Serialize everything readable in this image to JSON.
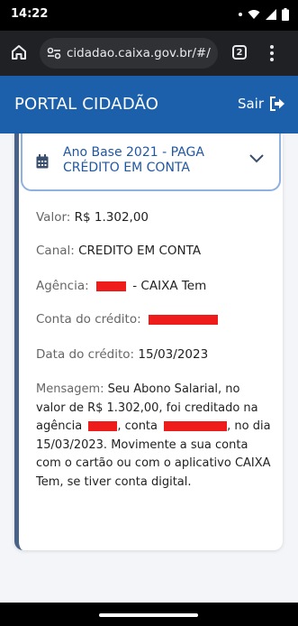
{
  "status_bar": {
    "time": "14:22"
  },
  "browser": {
    "url": "cidadao.caixa.gov.br/#/a",
    "tab_count": "2"
  },
  "header": {
    "title": "PORTAL CIDADÃO",
    "logout_label": "Sair"
  },
  "accordion": {
    "title": "Ano Base 2021 - PAGA CRÉDITO EM CONTA"
  },
  "details": {
    "valor_label": "Valor:",
    "valor_value": "R$ 1.302,00",
    "canal_label": "Canal:",
    "canal_value": "CREDITO EM CONTA",
    "agencia_label": "Agência:",
    "agencia_suffix": "- CAIXA Tem",
    "conta_label": "Conta do crédito:",
    "data_label": "Data do crédito:",
    "data_value": "15/03/2023",
    "mensagem_label": "Mensagem:",
    "mensagem_part1": "Seu Abono Salarial, no valor de R$  1.302,00, foi creditado na agência",
    "mensagem_part2": ", conta",
    "mensagem_part3": ", no dia 15/03/2023. Movimente a sua conta com o cartão ou com o aplicativo CAIXA Tem, se tiver conta digital."
  },
  "colors": {
    "brand_blue": "#1c60ab",
    "title_blue": "#1f57a3",
    "redaction": "#ef1c1c"
  }
}
